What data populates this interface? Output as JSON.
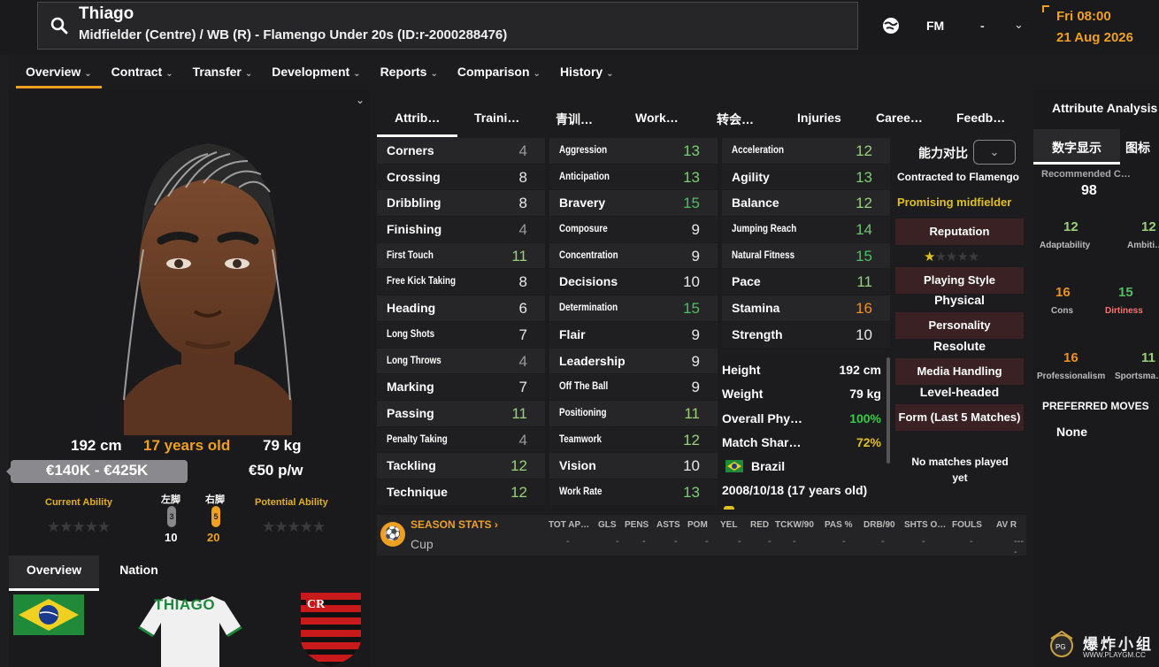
{
  "header": {
    "name": "Thiago",
    "subtitle": "Midfielder (Centre) / WB (R) - Flamengo Under 20s (ID:r-2000288476)",
    "fm_label": "FM",
    "fm_dash": "-",
    "date_day": "Fri 08:00",
    "date_date": "21 Aug 2026"
  },
  "tabs": [
    "Overview",
    "Contract",
    "Transfer",
    "Development",
    "Reports",
    "Comparison",
    "History"
  ],
  "bio": {
    "height": "192 cm",
    "age": "17 years old",
    "weight": "79 kg",
    "value": "€140K - €425K",
    "wage": "€50 p/w",
    "current_ability_label": "Current Ability",
    "potential_ability_label": "Potential Ability",
    "current_ability_stars": 0,
    "potential_ability_stars": 0,
    "left_foot_label": "左脚",
    "right_foot_label": "右脚",
    "left_foot_rating": "3",
    "right_foot_rating": "5",
    "left_foot_value": "10",
    "right_foot_value": "20"
  },
  "sub_tabs": {
    "overview": "Overview",
    "nation": "Nation"
  },
  "jersey_name": "THIAGO",
  "mid_tabs": [
    "Attrib…",
    "Traini…",
    "青训…",
    "Work…",
    "转会…",
    "Injuries",
    "Caree…",
    "Feedb…"
  ],
  "technical": [
    {
      "name": "Corners",
      "value": "4",
      "color": "#9a9a9a"
    },
    {
      "name": "Crossing",
      "value": "8",
      "color": "#e8e8e8"
    },
    {
      "name": "Dribbling",
      "value": "8",
      "color": "#e8e8e8"
    },
    {
      "name": "Finishing",
      "value": "4",
      "color": "#9a9a9a"
    },
    {
      "name": "First Touch",
      "value": "11",
      "color": "#9ad07a"
    },
    {
      "name": "Free Kick Taking",
      "value": "8",
      "color": "#e8e8e8"
    },
    {
      "name": "Heading",
      "value": "6",
      "color": "#e8e8e8"
    },
    {
      "name": "Long Shots",
      "value": "7",
      "color": "#e8e8e8"
    },
    {
      "name": "Long Throws",
      "value": "4",
      "color": "#9a9a9a"
    },
    {
      "name": "Marking",
      "value": "7",
      "color": "#e8e8e8"
    },
    {
      "name": "Passing",
      "value": "11",
      "color": "#9ad07a"
    },
    {
      "name": "Penalty Taking",
      "value": "4",
      "color": "#9a9a9a"
    },
    {
      "name": "Tackling",
      "value": "12",
      "color": "#9ad07a"
    },
    {
      "name": "Technique",
      "value": "12",
      "color": "#9ad07a"
    }
  ],
  "mental": [
    {
      "name": "Aggression",
      "value": "13",
      "color": "#7ad070"
    },
    {
      "name": "Anticipation",
      "value": "13",
      "color": "#7ad070"
    },
    {
      "name": "Bravery",
      "value": "15",
      "color": "#4ec060"
    },
    {
      "name": "Composure",
      "value": "9",
      "color": "#e8e8e8"
    },
    {
      "name": "Concentration",
      "value": "9",
      "color": "#e8e8e8"
    },
    {
      "name": "Decisions",
      "value": "10",
      "color": "#e8e8e8"
    },
    {
      "name": "Determination",
      "value": "15",
      "color": "#4ec060"
    },
    {
      "name": "Flair",
      "value": "9",
      "color": "#e8e8e8"
    },
    {
      "name": "Leadership",
      "value": "9",
      "color": "#e8e8e8"
    },
    {
      "name": "Off The Ball",
      "value": "9",
      "color": "#e8e8e8"
    },
    {
      "name": "Positioning",
      "value": "11",
      "color": "#9ad07a"
    },
    {
      "name": "Teamwork",
      "value": "12",
      "color": "#9ad07a"
    },
    {
      "name": "Vision",
      "value": "10",
      "color": "#e8e8e8"
    },
    {
      "name": "Work Rate",
      "value": "13",
      "color": "#7ad070"
    }
  ],
  "physical": [
    {
      "name": "Acceleration",
      "value": "12",
      "color": "#9ad07a"
    },
    {
      "name": "Agility",
      "value": "13",
      "color": "#7ad070"
    },
    {
      "name": "Balance",
      "value": "12",
      "color": "#9ad07a"
    },
    {
      "name": "Jumping Reach",
      "value": "14",
      "color": "#6ac868"
    },
    {
      "name": "Natural Fitness",
      "value": "15",
      "color": "#4ec060"
    },
    {
      "name": "Pace",
      "value": "11",
      "color": "#9ad07a"
    },
    {
      "name": "Stamina",
      "value": "16",
      "color": "#f09020"
    },
    {
      "name": "Strength",
      "value": "10",
      "color": "#e8e8e8"
    }
  ],
  "phys_info": {
    "height_label": "Height",
    "height_value": "192 cm",
    "weight_label": "Weight",
    "weight_value": "79 kg",
    "overall_label": "Overall Phy…",
    "overall_value": "100%",
    "match_label": "Match Shar…",
    "match_value": "72%",
    "nation": "Brazil",
    "dob": "2008/10/18 (17 years old)"
  },
  "info": {
    "compare_label": "能力对比",
    "contracted": "Contracted to Flamengo",
    "promising": "Promising midfielder",
    "reputation_label": "Reputation",
    "reputation_stars": 0.5,
    "playing_style_label": "Playing Style",
    "playing_style": "Physical",
    "personality_label": "Personality",
    "personality": "Resolute",
    "media_label": "Media Handling",
    "media": "Level-headed",
    "form_label": "Form (Last 5 Matches)",
    "no_matches": "No matches played yet"
  },
  "season": {
    "title": "SEASON STATS",
    "row_label": "Cup",
    "headers": [
      "TOT AP…",
      "GLS",
      "PENS",
      "ASTS",
      "POM",
      "YEL",
      "RED",
      "TCKW/90",
      "PAS %",
      "DRB/90",
      "SHTS O…",
      "FOULS",
      "AV R"
    ],
    "values": [
      "-",
      "-",
      "-",
      "-",
      "-",
      "-",
      "-",
      "-",
      "-",
      "-",
      "-",
      "-",
      "----"
    ]
  },
  "right_panel": {
    "title": "Attribute Analysis",
    "tab1": "数字显示",
    "tab2": "图标",
    "recommended_label": "Recommended C…",
    "recommended_value": "98",
    "attributes": [
      {
        "name": "Adaptability",
        "value": "12",
        "color": "#9ad07a",
        "label_color": "#bbbbbb"
      },
      {
        "name": "Ambiti…",
        "value": "12",
        "color": "#9ad07a",
        "label_color": "#bbbbbb"
      },
      {
        "name": "Cons",
        "value": "16",
        "color": "#f09020",
        "label_color": "#bbbbbb"
      },
      {
        "name": "Dirtiness",
        "value": "15",
        "color": "#4ec060",
        "label_color": "#ff7070"
      },
      {
        "name": "Professionalism",
        "value": "16",
        "color": "#f09020",
        "label_color": "#bbbbbb"
      },
      {
        "name": "Sportsma…",
        "value": "11",
        "color": "#9ad07a",
        "label_color": "#bbbbbb"
      }
    ],
    "preferred_moves_label": "PREFERRED MOVES",
    "preferred_moves_value": "None"
  },
  "watermark": {
    "text": "爆炸小组",
    "url": "WWW.PLAYGM.CC"
  }
}
